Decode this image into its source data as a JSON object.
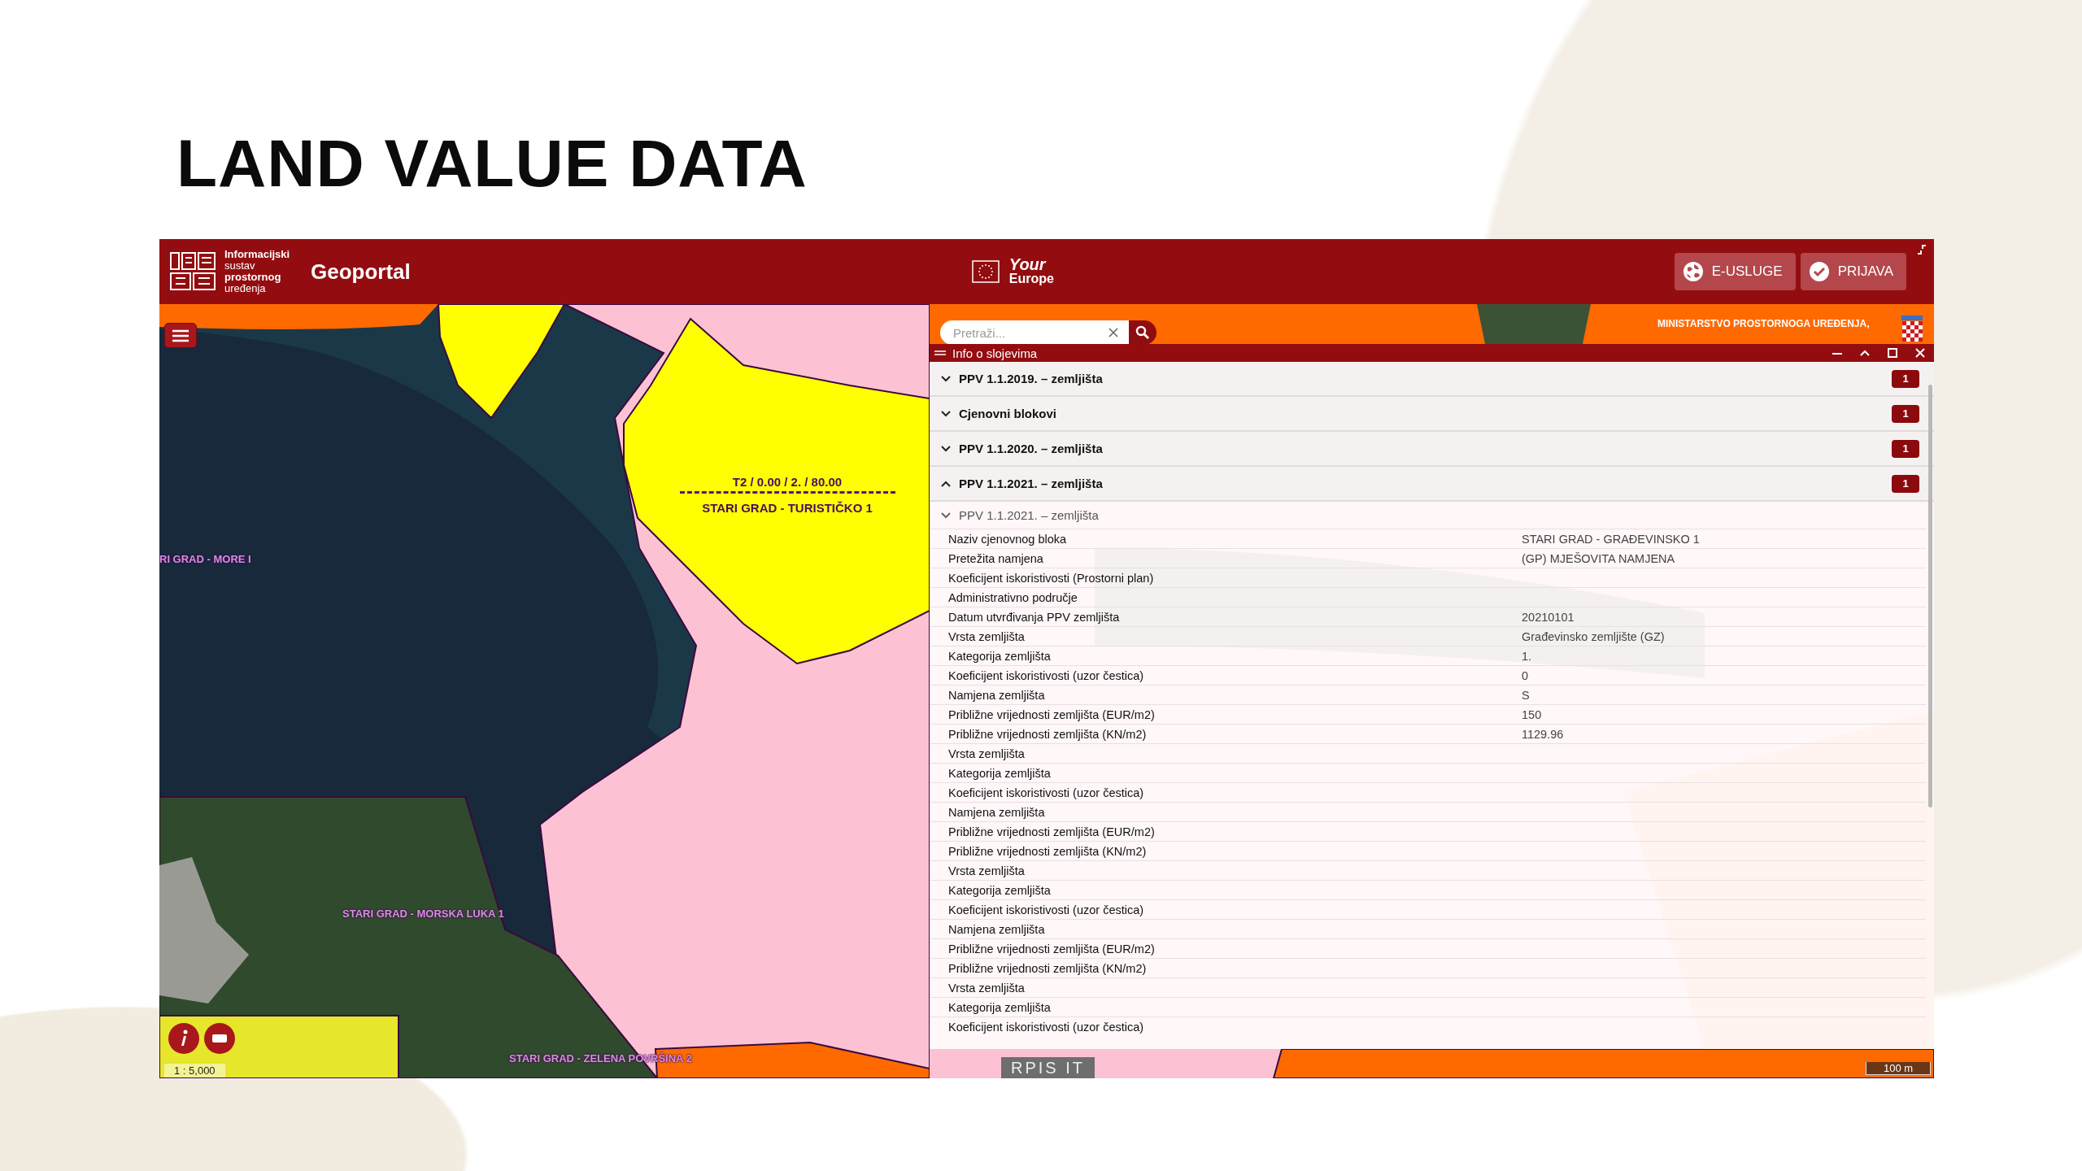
{
  "slide": {
    "title": "LAND VALUE DATA"
  },
  "header": {
    "logo_lines": [
      "Informacijski",
      "sustav",
      "prostornog",
      "uređenja"
    ],
    "app_name": "Geoportal",
    "eu_badge": {
      "line_1": "Your",
      "line_2": "Europe"
    },
    "buttons": [
      {
        "label": "E-USLUGE",
        "kind": "services"
      },
      {
        "label": "PRIJAVA",
        "kind": "login"
      }
    ]
  },
  "map": {
    "search": {
      "placeholder": "Pretraži..."
    },
    "ministry": "MINISTARSTVO PROSTORNOGA UREĐENJA,",
    "labels": [
      {
        "text": "T2 / 0.00 / 2. / 80.00",
        "kind": "code"
      },
      {
        "text": "STARI GRAD - TURISTIČKO 1",
        "kind": "zone"
      },
      {
        "text": "RI GRAD - MORE I",
        "kind": "zone"
      },
      {
        "text": "STARI GRAD - MORSKA LUKA 1",
        "kind": "zone"
      },
      {
        "text": "STARI GRAD - ZELENA POVRŠINA 2",
        "kind": "zone"
      }
    ],
    "scale": "1 : 5,000",
    "scale_bar": "100 m",
    "footer_logo": "RPIS IT"
  },
  "panel": {
    "title": "Info o slojevima",
    "sections": [
      {
        "label": "PPV 1.1.2019. – zemljišta",
        "count": "1",
        "expanded": false
      },
      {
        "label": "Cjenovni blokovi",
        "count": "1",
        "expanded": false
      },
      {
        "label": "PPV 1.1.2020. – zemljišta",
        "count": "1",
        "expanded": false
      },
      {
        "label": "PPV 1.1.2021. – zemljišta",
        "count": "1",
        "expanded": true
      }
    ],
    "subsection": {
      "label": "PPV 1.1.2021. – zemljišta"
    },
    "attributes": [
      {
        "label": "Naziv cjenovnog bloka",
        "value": "STARI GRAD - GRAĐEVINSKO 1"
      },
      {
        "label": "Pretežita namjena",
        "value": "(GP) MJEŠOVITA NAMJENA"
      },
      {
        "label": "Koeficijent iskoristivosti (Prostorni plan)"
      },
      {
        "label": "Administrativno područje"
      },
      {
        "label": "Datum utvrđivanja PPV zemljišta",
        "value": "20210101"
      },
      {
        "label": "Vrsta zemljišta",
        "value": "Građevinsko zemljište (GZ)"
      },
      {
        "label": "Kategorija zemljišta",
        "value": "1."
      },
      {
        "label": "Koeficijent iskoristivosti (uzor čestica)",
        "value": "0"
      },
      {
        "label": "Namjena zemljišta",
        "value": "S"
      },
      {
        "label": "Približne vrijednosti zemljišta (EUR/m2)",
        "value": "150"
      },
      {
        "label": "Približne vrijednosti zemljišta (KN/m2)",
        "value": "1129.96"
      },
      {
        "label": "Vrsta zemljišta"
      },
      {
        "label": "Kategorija zemljišta"
      },
      {
        "label": "Koeficijent iskoristivosti (uzor čestica)"
      },
      {
        "label": "Namjena zemljišta"
      },
      {
        "label": "Približne vrijednosti zemljišta (EUR/m2)"
      },
      {
        "label": "Približne vrijednosti zemljišta (KN/m2)"
      },
      {
        "label": "Vrsta zemljišta"
      },
      {
        "label": "Kategorija zemljišta"
      },
      {
        "label": "Koeficijent iskoristivosti (uzor čestica)"
      },
      {
        "label": "Namjena zemljišta"
      },
      {
        "label": "Približne vrijednosti zemljišta (EUR/m2)"
      },
      {
        "label": "Približne vrijednosti zemljišta (KN/m2)"
      },
      {
        "label": "Vrsta zemljišta"
      },
      {
        "label": "Kategorija zemljišta"
      },
      {
        "label": "Koeficijent iskoristivosti (uzor čestica)"
      }
    ]
  }
}
